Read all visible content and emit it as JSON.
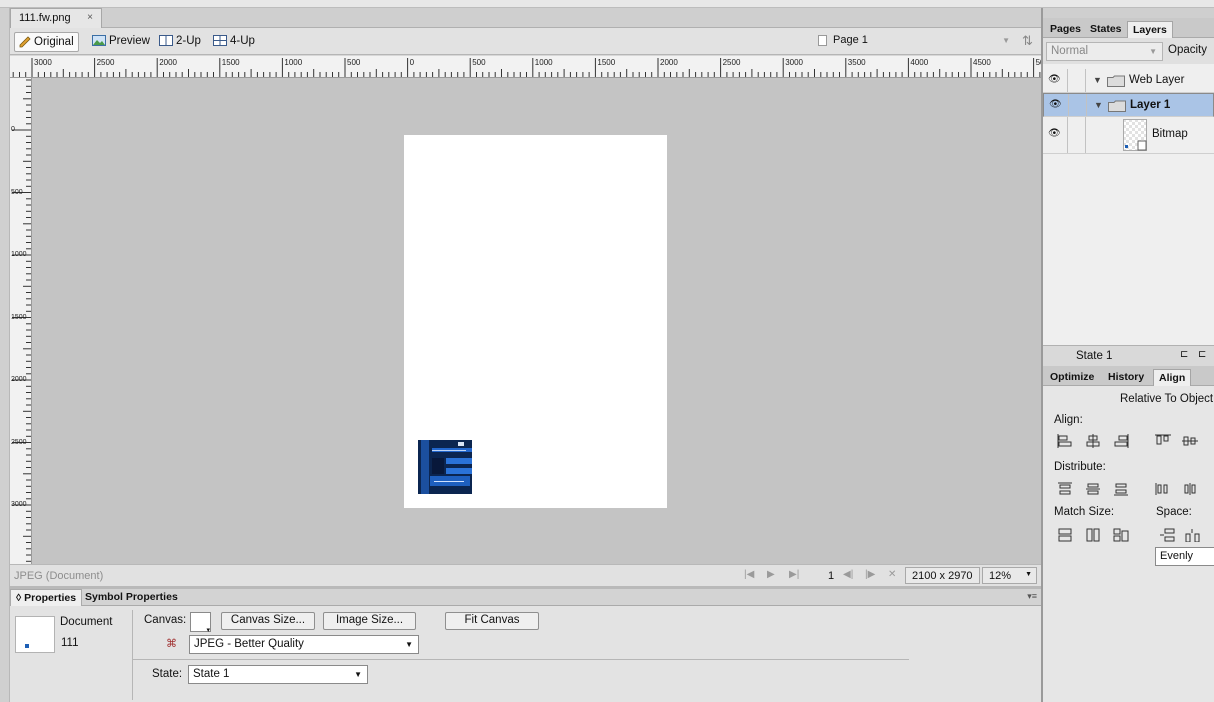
{
  "document_tab": {
    "title": "111.fw.png",
    "close": "×"
  },
  "view_toolbar": {
    "original": "Original",
    "preview": "Preview",
    "two_up": "2-Up",
    "four_up": "4-Up",
    "page": "Page 1"
  },
  "rulers": {
    "horizontal": [
      "3000",
      "2500",
      "2000",
      "1500",
      "1000",
      "500",
      "0",
      "500",
      "1000",
      "1500",
      "2000",
      "2500",
      "3000",
      "3500",
      "4000",
      "4500",
      "50"
    ],
    "vertical": [
      "0",
      "500",
      "1000",
      "1500",
      "2000",
      "2500",
      "3000"
    ]
  },
  "status_bar": {
    "format": "JPEG (Document)",
    "frame": "1",
    "size": "2100 x 2970",
    "zoom": "12%"
  },
  "properties": {
    "tabs": [
      "Properties",
      "Symbol Properties"
    ],
    "doc_label": "Document",
    "doc_name": "111",
    "canvas_label": "Canvas:",
    "canvas_size_btn": "Canvas Size...",
    "image_size_btn": "Image Size...",
    "fit_canvas_btn": "Fit Canvas",
    "optimize_value": "JPEG - Better Quality",
    "state_label": "State:",
    "state_value": "State 1"
  },
  "right_panel": {
    "tabs_top": [
      "Pages",
      "States",
      "Layers"
    ],
    "blend_mode": "Normal",
    "opacity_label": "Opacity",
    "layers": [
      {
        "name": "Web Layer",
        "type": "folder",
        "selected": false
      },
      {
        "name": "Layer 1",
        "type": "folder",
        "selected": true
      },
      {
        "name": "Bitmap",
        "type": "bitmap",
        "selected": false
      }
    ],
    "state_footer": "State 1",
    "tabs_bottom": [
      "Optimize",
      "History",
      "Align"
    ],
    "align": {
      "relative_to": "Relative To Object",
      "align_label": "Align:",
      "distribute_label": "Distribute:",
      "match_size_label": "Match Size:",
      "space_label": "Space:",
      "space_value": "Evenly"
    }
  },
  "colors": {
    "accent_selection": "#aac4e6",
    "canvas_bg": "#c4c4c4",
    "thumb_blue": "#1d5fb5"
  }
}
